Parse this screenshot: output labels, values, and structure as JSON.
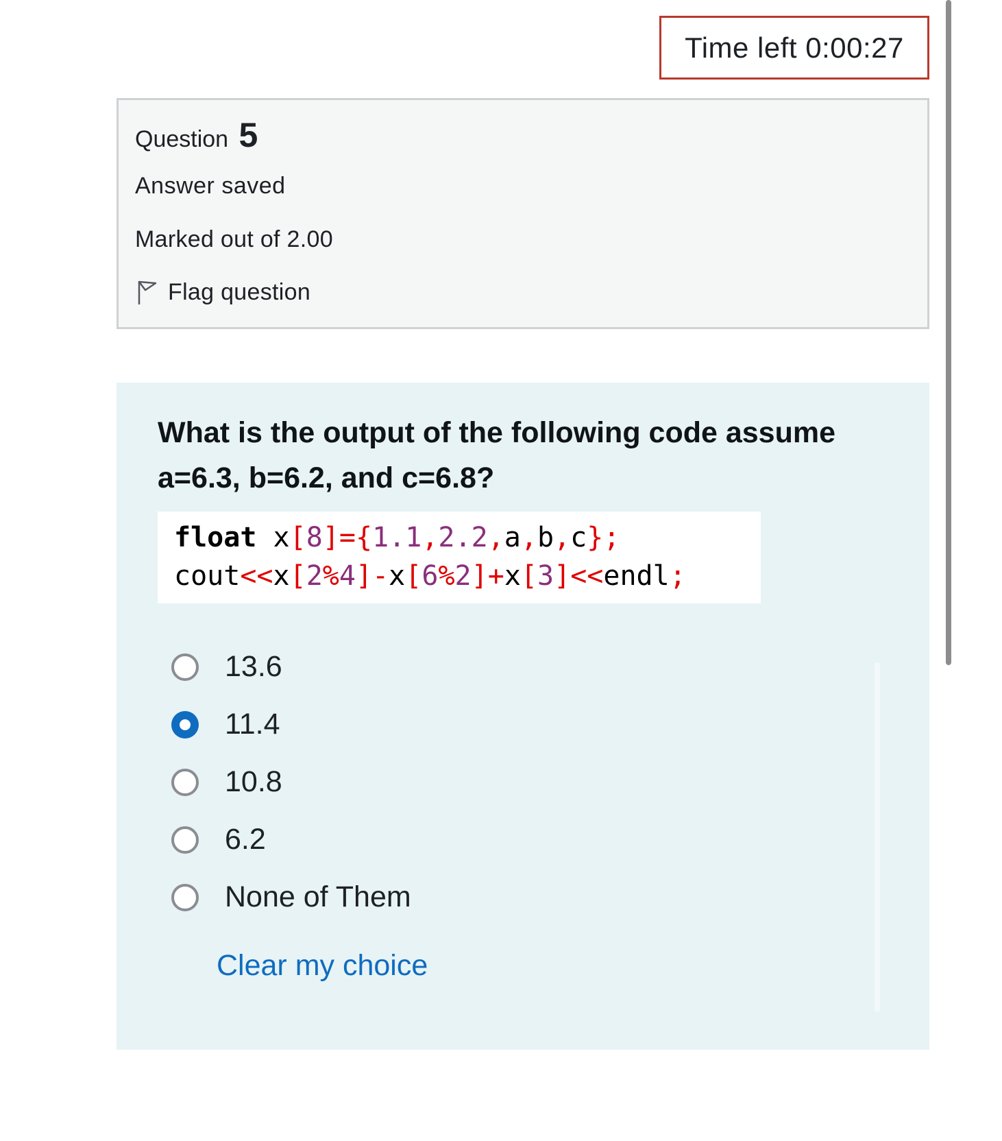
{
  "timer": {
    "label": "Time left 0:00:27"
  },
  "question_info": {
    "question_label": "Question",
    "question_number": "5",
    "state": "Answer saved",
    "grade": "Marked out of 2.00",
    "flag_label": "Flag question"
  },
  "question": {
    "text_line1": "What is the output of the following code assume",
    "text_line2": "a=6.3, b=6.2, and c=6.8?",
    "code_lines": [
      "float x[8]={1.1,2.2,a,b,c};",
      "cout<<x[2%4]-x[6%2]+x[3]<<endl;"
    ],
    "options": [
      {
        "label": "13.6",
        "selected": false
      },
      {
        "label": "11.4",
        "selected": true
      },
      {
        "label": "10.8",
        "selected": false
      },
      {
        "label": "6.2",
        "selected": false
      },
      {
        "label": "None of Them",
        "selected": false
      }
    ],
    "clear_label": "Clear my choice"
  },
  "colors": {
    "accent": "#0f6cbf",
    "timer_border": "#b8392e",
    "question_bg": "#e7f3f5",
    "info_bg": "#f5f7f7"
  },
  "icons": {
    "flag": "flag-outline-icon"
  }
}
